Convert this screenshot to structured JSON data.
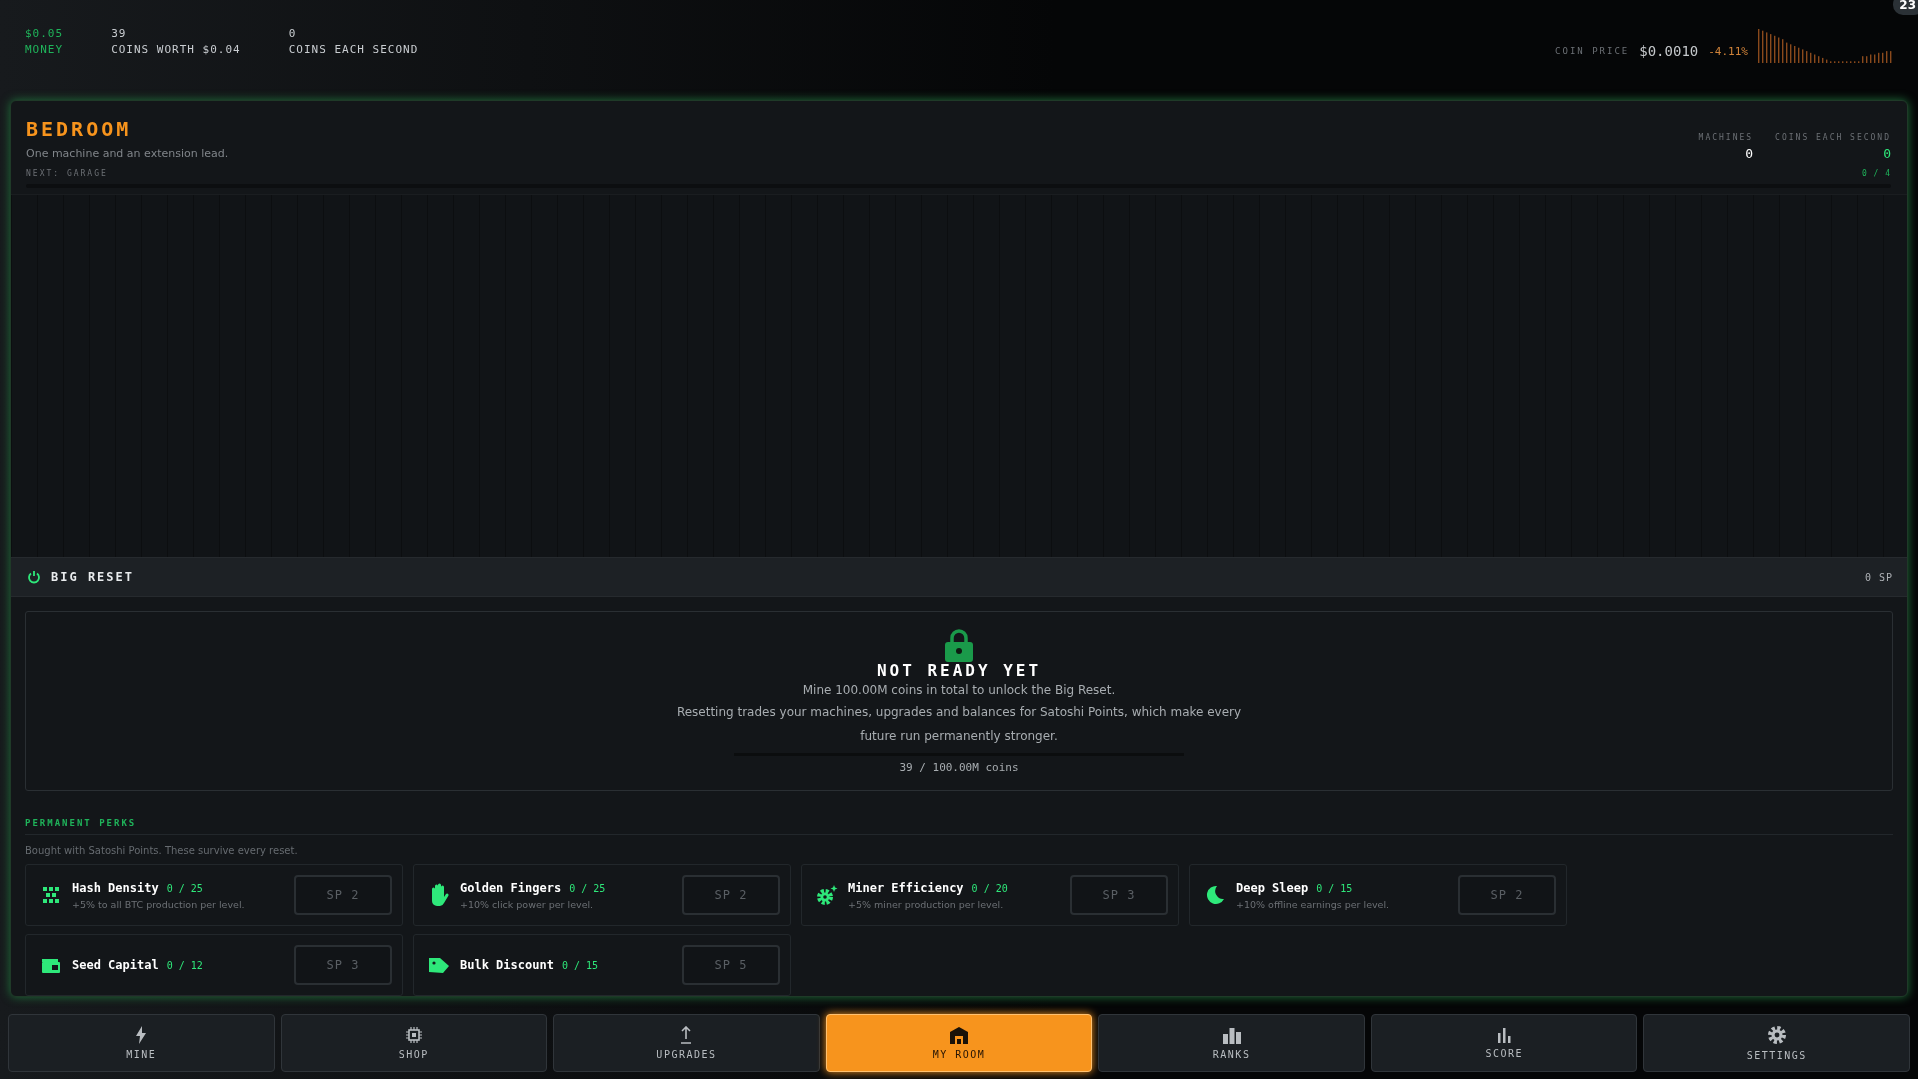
{
  "stats": [
    {
      "value": "$0.05",
      "label": "MONEY",
      "kind": "money"
    },
    {
      "value": "39",
      "label": "COINS WORTH $0.04",
      "kind": "plain"
    },
    {
      "value": "0",
      "label": "COINS EACH SECOND",
      "kind": "plain"
    }
  ],
  "coin_price": {
    "label": "COIN PRICE",
    "price": "$0.0010",
    "change": "-4.11%"
  },
  "corner_badge": "23",
  "room": {
    "title": "BEDROOM",
    "subtitle": "One machine and an extension lead.",
    "next": "NEXT: GARAGE",
    "progress_text": "0 / 4",
    "stats": [
      {
        "label": "MACHINES",
        "value": "0",
        "kind": "plain"
      },
      {
        "label": "COINS EACH SECOND",
        "value": "0",
        "kind": "accent"
      }
    ]
  },
  "big_reset": {
    "title": "BIG RESET",
    "points": "0 SP",
    "heading": "NOT READY YET",
    "requirement": "Mine 100.00M coins in total to unlock the Big Reset.",
    "explanation": "Resetting trades your machines, upgrades and balances for Satoshi Points, which make every future run permanently stronger.",
    "progress_text": "39 / 100.00M coins"
  },
  "perks": {
    "title": "PERMANENT PERKS",
    "subtitle": "Bought with Satoshi Points. These survive every reset.",
    "items": [
      {
        "name": "Hash Density",
        "count": "0 / 25",
        "description": "+5% to all BTC production per level.",
        "cost": "SP 2",
        "kind": "dots"
      },
      {
        "name": "Golden Fingers",
        "count": "0 / 25",
        "description": "+10% click power per level.",
        "cost": "SP 2",
        "kind": "hand"
      },
      {
        "name": "Miner Efficiency",
        "count": "0 / 20",
        "description": "+5% miner production per level.",
        "cost": "SP 3",
        "kind": "gear"
      },
      {
        "name": "Deep Sleep",
        "count": "0 / 15",
        "description": "+10% offline earnings per level.",
        "cost": "SP 2",
        "kind": "moon"
      },
      {
        "name": "Seed Capital",
        "count": "0 / 12",
        "cost": "SP 3",
        "kind": "wallet"
      },
      {
        "name": "Bulk Discount",
        "count": "0 / 15",
        "cost": "SP 5",
        "kind": "tag"
      }
    ]
  },
  "nav": [
    {
      "label": "MINE",
      "kind": "bolt",
      "selected": false
    },
    {
      "label": "SHOP",
      "kind": "chip",
      "selected": false
    },
    {
      "label": "UPGRADES",
      "kind": "upload",
      "selected": false
    },
    {
      "label": "MY ROOM",
      "kind": "house",
      "selected": true
    },
    {
      "label": "RANKS",
      "kind": "ranks",
      "selected": false
    },
    {
      "label": "SCORE",
      "kind": "bars",
      "selected": false
    },
    {
      "label": "SETTINGS",
      "kind": "gear",
      "selected": false
    }
  ]
}
